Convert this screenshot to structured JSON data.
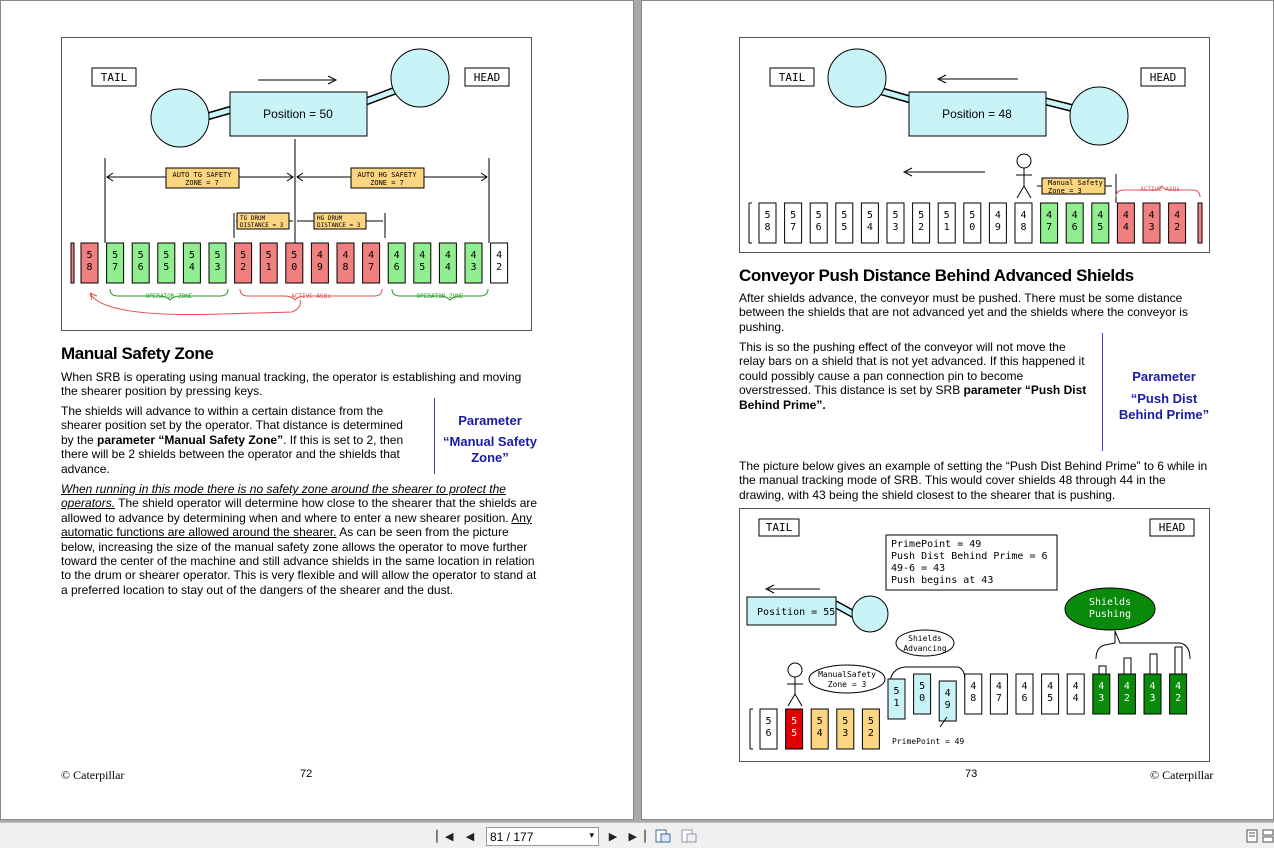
{
  "left_page": {
    "figure": {
      "tail": "TAIL",
      "head": "HEAD",
      "position": "Position = 50",
      "auto_tg": [
        "AUTO TG SAFETY",
        "ZONE = 7"
      ],
      "auto_hg": [
        "AUTO HG SAFETY",
        "ZONE = 7"
      ],
      "tg_drum": [
        "TG DRUM",
        "DISTANCE = 3"
      ],
      "hg_drum": [
        "HG DRUM",
        "DISTANCE = 3"
      ],
      "operator_zone": "OPERATOR ZONE",
      "active_asqs": "ACTIVE ASQs",
      "shields": [
        {
          "d": [
            "5",
            "8"
          ],
          "c": "red"
        },
        {
          "d": [
            "5",
            "7"
          ],
          "c": "green"
        },
        {
          "d": [
            "5",
            "6"
          ],
          "c": "green"
        },
        {
          "d": [
            "5",
            "5"
          ],
          "c": "green"
        },
        {
          "d": [
            "5",
            "4"
          ],
          "c": "green"
        },
        {
          "d": [
            "5",
            "3"
          ],
          "c": "green"
        },
        {
          "d": [
            "5",
            "2"
          ],
          "c": "red"
        },
        {
          "d": [
            "5",
            "1"
          ],
          "c": "red"
        },
        {
          "d": [
            "5",
            "0"
          ],
          "c": "red"
        },
        {
          "d": [
            "4",
            "9"
          ],
          "c": "red"
        },
        {
          "d": [
            "4",
            "8"
          ],
          "c": "red"
        },
        {
          "d": [
            "4",
            "7"
          ],
          "c": "red"
        },
        {
          "d": [
            "4",
            "6"
          ],
          "c": "green"
        },
        {
          "d": [
            "4",
            "5"
          ],
          "c": "green"
        },
        {
          "d": [
            "4",
            "4"
          ],
          "c": "green"
        },
        {
          "d": [
            "4",
            "3"
          ],
          "c": "green"
        },
        {
          "d": [
            "4",
            "2"
          ],
          "c": "white"
        }
      ]
    },
    "title": "Manual Safety Zone",
    "p1": "When SRB is operating using manual tracking, the operator is establishing and moving the shearer position by pressing keys.",
    "p2a": "The shields will advance to within a certain distance from the shearer position set by the operator.  That distance is determined by the ",
    "p2b": "parameter “Manual Safety Zone”",
    "p2c": ".  If this is set to 2, then there will be 2 shields between the operator and the shields that advance.",
    "side_label": "Parameter",
    "side_value": "“Manual Safety Zone”",
    "p3a": "When running in this mode there is no safety zone around the shearer to protect the operators.",
    "p3b": "  The shield operator will determine how close to the shearer that the shields are allowed to advance by determining when and where to enter a new shearer position.  ",
    "p3c": "Any automatic functions are allowed around the shearer.",
    "p3d": "  As can be seen from the picture below, increasing the size of the manual safety zone allows the operator to move further toward the center of the machine and still advance shields in the same location in relation to the drum or shearer operator.  This is very flexible and will allow the operator to stand at a preferred location to stay out of the dangers of the shearer and the dust.",
    "footer": "© Caterpillar",
    "page_number": "72"
  },
  "right_page": {
    "figure1": {
      "tail": "TAIL",
      "head": "HEAD",
      "position": "Position = 48",
      "manual_zone": [
        "Manual Safety",
        "Zone  = 3"
      ],
      "active_asqs": "ACTIVE ASQs",
      "shields": [
        {
          "d": [
            "5",
            "8"
          ],
          "c": "white"
        },
        {
          "d": [
            "5",
            "7"
          ],
          "c": "white"
        },
        {
          "d": [
            "5",
            "6"
          ],
          "c": "white"
        },
        {
          "d": [
            "5",
            "5"
          ],
          "c": "white"
        },
        {
          "d": [
            "5",
            "4"
          ],
          "c": "white"
        },
        {
          "d": [
            "5",
            "3"
          ],
          "c": "white"
        },
        {
          "d": [
            "5",
            "2"
          ],
          "c": "white"
        },
        {
          "d": [
            "5",
            "1"
          ],
          "c": "white"
        },
        {
          "d": [
            "5",
            "0"
          ],
          "c": "white"
        },
        {
          "d": [
            "4",
            "9"
          ],
          "c": "white"
        },
        {
          "d": [
            "4",
            "8"
          ],
          "c": "white"
        },
        {
          "d": [
            "4",
            "7"
          ],
          "c": "green"
        },
        {
          "d": [
            "4",
            "6"
          ],
          "c": "green"
        },
        {
          "d": [
            "4",
            "5"
          ],
          "c": "green"
        },
        {
          "d": [
            "4",
            "4"
          ],
          "c": "red"
        },
        {
          "d": [
            "4",
            "3"
          ],
          "c": "red"
        },
        {
          "d": [
            "4",
            "2"
          ],
          "c": "red"
        }
      ]
    },
    "title": "Conveyor Push Distance Behind Advanced Shields",
    "p1": "After shields advance, the conveyor must be pushed.  There must be some distance between the shields that are not advanced yet and the shields where the conveyor is pushing.",
    "p2a": "This is so the pushing effect of the conveyor will not move the relay bars on a shield that is not yet advanced.  If this happened it could possibly cause a pan connection pin to become overstressed.  This distance is set by SRB ",
    "p2b": "parameter “Push Dist Behind Prime”.",
    "side_label": "Parameter",
    "side_value": "“Push Dist Behind Prime”",
    "p3": "The picture below gives an example of setting the “Push Dist Behind Prime” to 6 while in the manual tracking mode of SRB.  This would cover shields 48 through 44 in the drawing, with 43 being the shield closest to the shearer that is pushing.",
    "figure2": {
      "tail": "TAIL",
      "head": "HEAD",
      "position": "Position = 55",
      "info": [
        "PrimePoint = 49",
        "Push Dist Behind Prime = 6",
        "49-6 = 43",
        "Push begins at 43"
      ],
      "shields_pushing": [
        "Shields",
        "Pushing"
      ],
      "shields_advancing": [
        "Shields",
        "Advancing"
      ],
      "manual_zone": [
        "ManualSafety",
        "Zone = 3"
      ],
      "prime_point": "PrimePoint = 49",
      "shields": [
        {
          "d": [
            "5",
            "6"
          ],
          "c": "white"
        },
        {
          "d": [
            "5",
            "5"
          ],
          "c": "red"
        },
        {
          "d": [
            "5",
            "4"
          ],
          "c": "orange"
        },
        {
          "d": [
            "5",
            "3"
          ],
          "c": "orange"
        },
        {
          "d": [
            "5",
            "2"
          ],
          "c": "orange"
        },
        {
          "d": [
            "5",
            "1"
          ],
          "c": "cyan"
        },
        {
          "d": [
            "5",
            "0"
          ],
          "c": "cyan"
        },
        {
          "d": [
            "4",
            "9"
          ],
          "c": "cyan"
        },
        {
          "d": [
            "4",
            "8"
          ],
          "c": "white"
        },
        {
          "d": [
            "4",
            "7"
          ],
          "c": "white"
        },
        {
          "d": [
            "4",
            "6"
          ],
          "c": "white"
        },
        {
          "d": [
            "4",
            "5"
          ],
          "c": "white"
        },
        {
          "d": [
            "4",
            "4"
          ],
          "c": "white"
        },
        {
          "d": [
            "4",
            "3"
          ],
          "c": "dkgreen"
        },
        {
          "d": [
            "4",
            "2"
          ],
          "c": "dkgreen"
        },
        {
          "d": [
            "4",
            "3"
          ],
          "c": "dkgreen"
        },
        {
          "d": [
            "4",
            "2"
          ],
          "c": "dkgreen"
        }
      ]
    },
    "footer": "© Caterpillar",
    "page_number": "73"
  },
  "toolbar": {
    "page_indicator": "81 / 177",
    "icons": [
      "first-page-icon",
      "prev-page-icon",
      "next-page-icon",
      "last-page-icon",
      "fit-page-icon",
      "fit-width-icon",
      "single-page-icon",
      "continuous-icon"
    ]
  },
  "colors": {
    "green": "#90ee90",
    "red": "#f08080",
    "orange": "#fcd581",
    "cyan": "#c8f4f8",
    "dkgreen": "#0a8a0a",
    "brightred": "#e00000",
    "blue_text": "#1a1aa8"
  }
}
